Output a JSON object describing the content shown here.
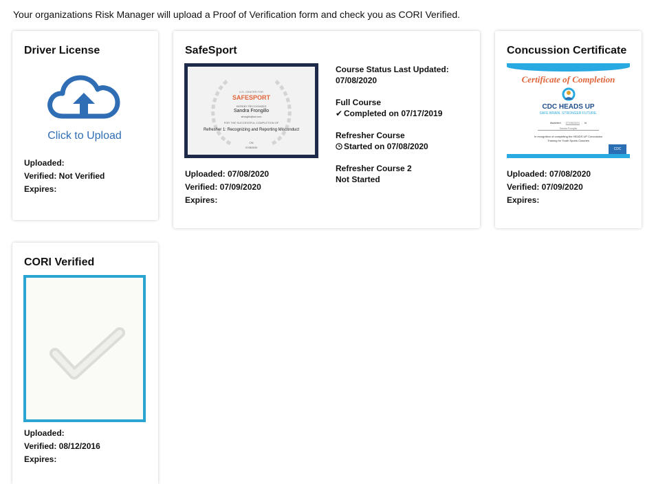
{
  "notice": "Your organizations Risk Manager will upload a Proof of Verification form and check you as CORI Verified.",
  "colors": {
    "upload_blue": "#2f6db4",
    "cori_border": "#2aa4d1",
    "safesport_frame": "#1d2a4a",
    "cdc_banner": "#29a9e1"
  },
  "cards": {
    "driver_license": {
      "title": "Driver License",
      "upload_label": "Click to Upload",
      "upload_icon": "cloud-upload-icon",
      "uploaded": "Uploaded:",
      "verified": "Verified: Not Verified",
      "expires": "Expires:"
    },
    "safesport": {
      "title": "SafeSport",
      "uploaded": "Uploaded: 07/08/2020",
      "verified": "Verified: 07/09/2020",
      "expires": "Expires:",
      "thumb": {
        "org_top": "U.S. CENTER FOR",
        "org": "SAFESPORT",
        "line1": "HEREBY RECOGNIZES",
        "name": "Sandra Frongillo",
        "email": "sfrongillo@aol.com",
        "line2": "FOR THE SUCCESSFUL COMPLETION OF",
        "course": "Refresher 1: Recognizing and Reporting Misconduct",
        "on": "ON",
        "date": "07/08/2020"
      },
      "status": {
        "last_updated_label": "Course Status Last Updated:",
        "last_updated_date": "07/08/2020",
        "full_course": "Full Course",
        "full_course_status": "Completed on 07/17/2019",
        "full_course_icon": "checkmark-icon",
        "refresher": "Refresher Course",
        "refresher_status": "Started on 07/08/2020",
        "refresher_icon": "clock-icon",
        "refresher2": "Refresher Course 2",
        "refresher2_status": "Not Started"
      }
    },
    "concussion": {
      "title": "Concussion Certificate",
      "uploaded": "Uploaded: 07/08/2020",
      "verified": "Verified: 07/09/2020",
      "expires": "Expires:",
      "thumb": {
        "heading": "Certificate of Completion",
        "brand": "CDC HEADS UP",
        "tagline": "SAFE BRAIN. STRONGER FUTURE.",
        "awarded": "Awarded",
        "awarded_date": "07/08/2020",
        "awarded_to": "to",
        "name": "Sandra Frongillo",
        "recognition": "In recognition of completing the HEADS UP Concussion",
        "recognition2": "Training for Youth Sports Coaches",
        "badge": "CDC"
      }
    },
    "cori": {
      "title": "CORI Verified",
      "check_icon": "checkmark-icon",
      "uploaded": "Uploaded:",
      "verified": "Verified: 08/12/2016",
      "expires": "Expires:"
    }
  }
}
